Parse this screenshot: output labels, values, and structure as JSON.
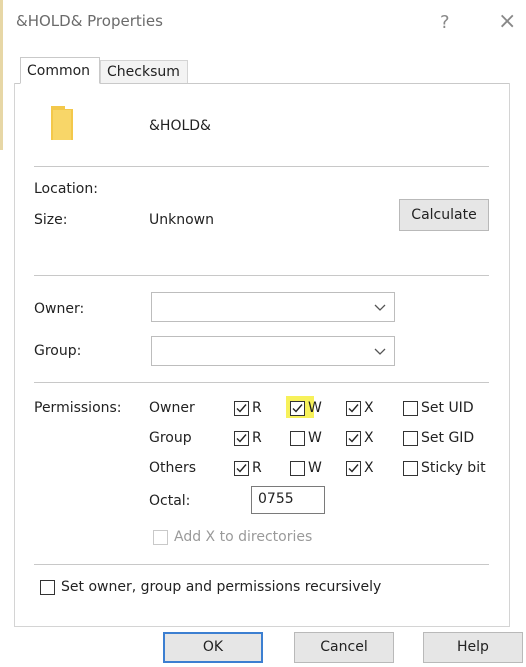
{
  "window": {
    "title": "&HOLD& Properties",
    "help_glyph": "?",
    "close_glyph": "×"
  },
  "tabs": [
    {
      "label": "Common"
    },
    {
      "label": "Checksum"
    }
  ],
  "file": {
    "name": "&HOLD&"
  },
  "info": {
    "location_label": "Location:",
    "size_label": "Size:",
    "size_value": "Unknown",
    "calculate_label": "Calculate"
  },
  "ownership": {
    "owner_label": "Owner:",
    "group_label": "Group:"
  },
  "permissions": {
    "label": "Permissions:",
    "rows": [
      {
        "name": "Owner",
        "r": true,
        "w": true,
        "x": true,
        "extra": "Set UID",
        "extra_checked": false
      },
      {
        "name": "Group",
        "r": true,
        "w": false,
        "x": true,
        "extra": "Set GID",
        "extra_checked": false
      },
      {
        "name": "Others",
        "r": true,
        "w": false,
        "x": true,
        "extra": "Sticky bit",
        "extra_checked": false
      }
    ],
    "letters": {
      "r": "R",
      "w": "W",
      "x": "X"
    },
    "octal_label": "Octal:",
    "octal_value": "0755",
    "add_x_label": "Add X to directories"
  },
  "recursive_label": "Set owner, group and permissions recursively",
  "buttons": {
    "ok": "OK",
    "cancel": "Cancel",
    "help": "Help"
  },
  "colors": {
    "highlight": "#f7f15a",
    "folder": "#f3c84b"
  }
}
